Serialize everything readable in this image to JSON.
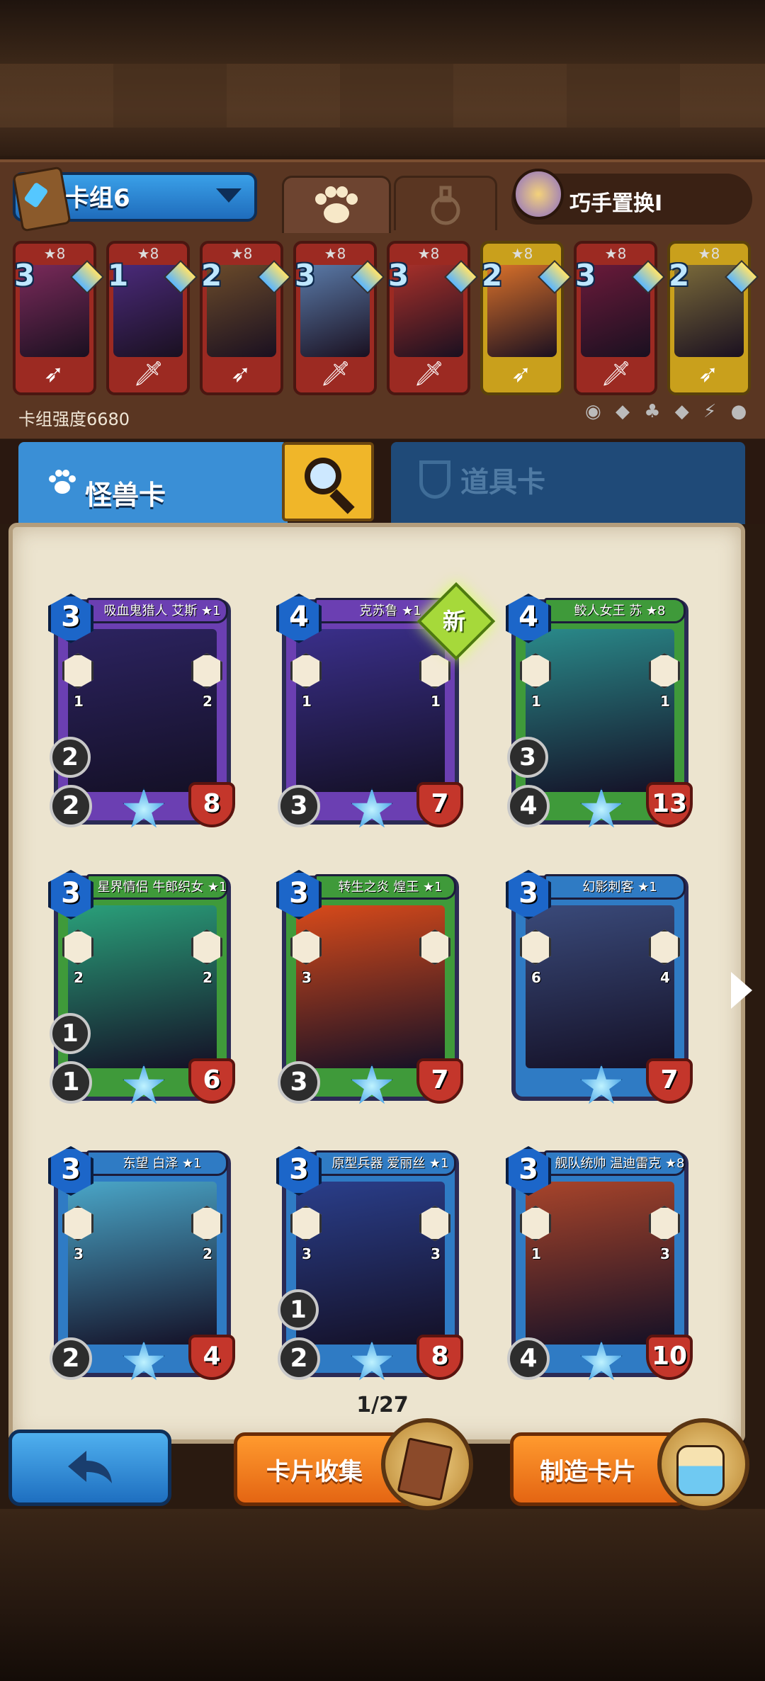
{
  "header": {
    "deck_name": "卡组6",
    "swap_label": "巧手置换I"
  },
  "deck": {
    "power_label": "卡组强度6680",
    "cards": [
      {
        "cost": "3",
        "stars": "★8",
        "frame": "red",
        "weapon": "bow-icon"
      },
      {
        "cost": "1",
        "stars": "★8",
        "frame": "red",
        "weapon": "sword-icon"
      },
      {
        "cost": "2",
        "stars": "★8",
        "frame": "red",
        "weapon": "bow-icon"
      },
      {
        "cost": "3",
        "stars": "★8",
        "frame": "red",
        "weapon": "sword-icon"
      },
      {
        "cost": "3",
        "stars": "★8",
        "frame": "red",
        "weapon": "sword-icon"
      },
      {
        "cost": "2",
        "stars": "★8",
        "frame": "gold",
        "weapon": "bow-icon"
      },
      {
        "cost": "3",
        "stars": "★8",
        "frame": "red",
        "weapon": "sword-icon"
      },
      {
        "cost": "2",
        "stars": "★8",
        "frame": "gold",
        "weapon": "bow-icon"
      }
    ]
  },
  "tabs": {
    "monster": "怪兽卡",
    "item": "道具卡"
  },
  "cards": [
    {
      "name": "吸血鬼猎人 艾斯 ★1",
      "cost": "3",
      "atk": "2",
      "atk2": "2",
      "hp": "8",
      "s1": "1",
      "s2": "2",
      "color": "#6b3fb2",
      "art": "#2c2360"
    },
    {
      "name": "克苏鲁 ★1",
      "cost": "4",
      "atk": "3",
      "atk2": "",
      "hp": "7",
      "s1": "1",
      "s2": "1",
      "color": "#6b3fb2",
      "art": "#3a2f8a"
    },
    {
      "name": "鲛人女王 苏 ★8",
      "cost": "4",
      "atk": "4",
      "atk2": "3",
      "hp": "13",
      "s1": "1",
      "s2": "1",
      "color": "#3f9a3a",
      "art": "#2a8a8a"
    },
    {
      "name": "星界情侣 牛郎织女 ★1",
      "cost": "3",
      "atk": "1",
      "atk2": "1",
      "hp": "6",
      "s1": "2",
      "s2": "2",
      "color": "#3f9a3a",
      "art": "#2aa07a"
    },
    {
      "name": "转生之炎 煌王 ★1",
      "cost": "3",
      "atk": "3",
      "atk2": "",
      "hp": "7",
      "s1": "3",
      "s2": "",
      "color": "#3f9a3a",
      "art": "#d84a1a"
    },
    {
      "name": "幻影刺客 ★1",
      "cost": "3",
      "atk": "",
      "atk2": "",
      "hp": "7",
      "s1": "6",
      "s2": "4",
      "color": "#2f7bc4",
      "art": "#3a4a7a"
    },
    {
      "name": "东望 白泽 ★1",
      "cost": "3",
      "atk": "2",
      "atk2": "",
      "hp": "4",
      "s1": "3",
      "s2": "2",
      "color": "#2f7bc4",
      "art": "#4aa6c8"
    },
    {
      "name": "原型兵器 爱丽丝 ★1",
      "cost": "3",
      "atk": "2",
      "atk2": "1",
      "hp": "8",
      "s1": "3",
      "s2": "3",
      "color": "#2f7bc4",
      "art": "#2a3e8a"
    },
    {
      "name": "舰队统帅 温迪雷克 ★8",
      "cost": "3",
      "atk": "4",
      "atk2": "",
      "hp": "10",
      "s1": "1",
      "s2": "3",
      "color": "#2f7bc4",
      "art": "#a8442a"
    }
  ],
  "new_badge": "新",
  "pager": "1/27",
  "buttons": {
    "collection": "卡片收集",
    "craft": "制造卡片"
  }
}
